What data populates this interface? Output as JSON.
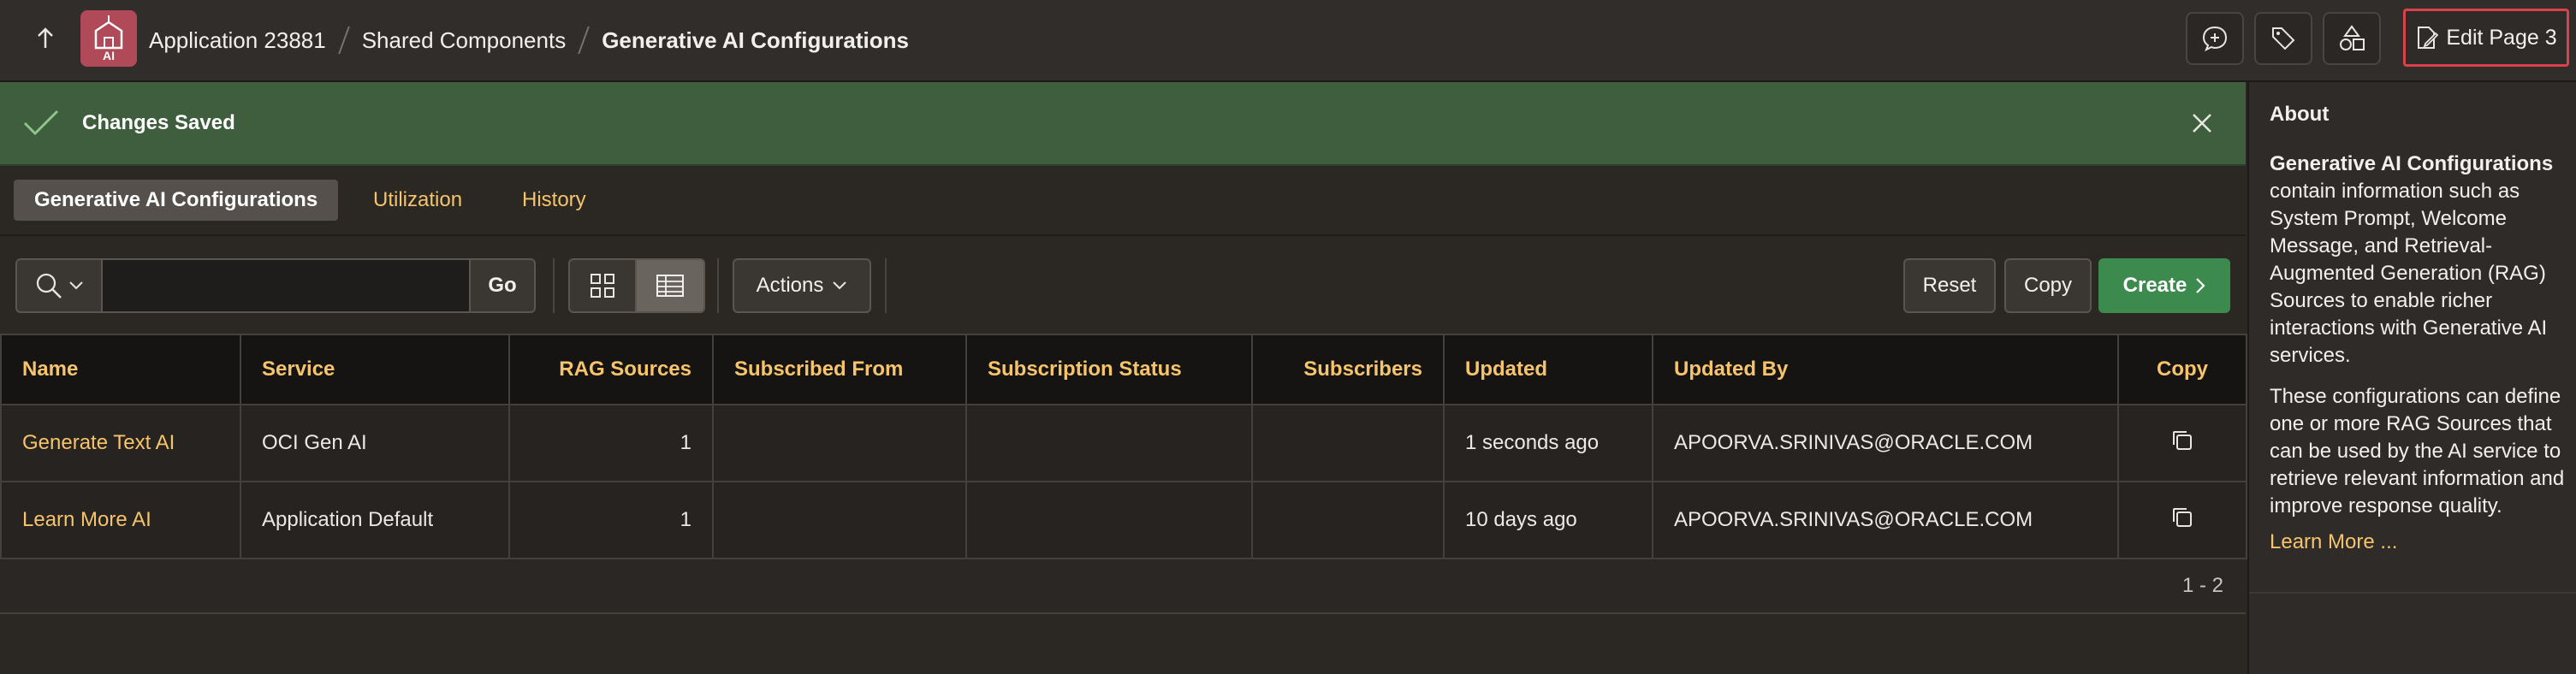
{
  "header": {
    "app_icon_label": "AI",
    "breadcrumb": [
      "Application 23881",
      "Shared Components",
      "Generative AI Configurations"
    ],
    "edit_button": "Edit Page 3"
  },
  "banner": {
    "message": "Changes Saved"
  },
  "tabs": [
    {
      "label": "Generative AI Configurations",
      "active": true
    },
    {
      "label": "Utilization",
      "active": false
    },
    {
      "label": "History",
      "active": false
    }
  ],
  "toolbar": {
    "search_value": "",
    "go_label": "Go",
    "actions_label": "Actions",
    "reset_label": "Reset",
    "copy_label": "Copy",
    "create_label": "Create"
  },
  "table": {
    "columns": [
      "Name",
      "Service",
      "RAG Sources",
      "Subscribed From",
      "Subscription Status",
      "Subscribers",
      "Updated",
      "Updated By",
      "Copy"
    ],
    "rows": [
      {
        "name": "Generate Text AI",
        "service": "OCI Gen AI",
        "rag_sources": "1",
        "subscribed_from": "",
        "subscription_status": "",
        "subscribers": "",
        "updated": "1 seconds ago",
        "updated_by": "APOORVA.SRINIVAS@ORACLE.COM"
      },
      {
        "name": "Learn More AI",
        "service": "Application Default",
        "rag_sources": "1",
        "subscribed_from": "",
        "subscription_status": "",
        "subscribers": "",
        "updated": "10 days ago",
        "updated_by": "APOORVA.SRINIVAS@ORACLE.COM"
      }
    ],
    "pagination": "1 - 2"
  },
  "about": {
    "title": "About",
    "p1_bold": "Generative AI Configurations",
    "p1_rest": " contain information such as System Prompt, Welcome Message, and Retrieval-Augmented Generation (RAG) Sources to enable richer interactions with Generative AI services.",
    "p2": "These configurations can define one or more RAG Sources that can be used by the AI service to retrieve relevant information and improve response quality.",
    "learn_more": "Learn More ..."
  },
  "colors": {
    "accent": "#f5c46b",
    "success_banner": "#3f5e3e",
    "create_button": "#3d8a4e",
    "edit_highlight": "#d9424a"
  }
}
